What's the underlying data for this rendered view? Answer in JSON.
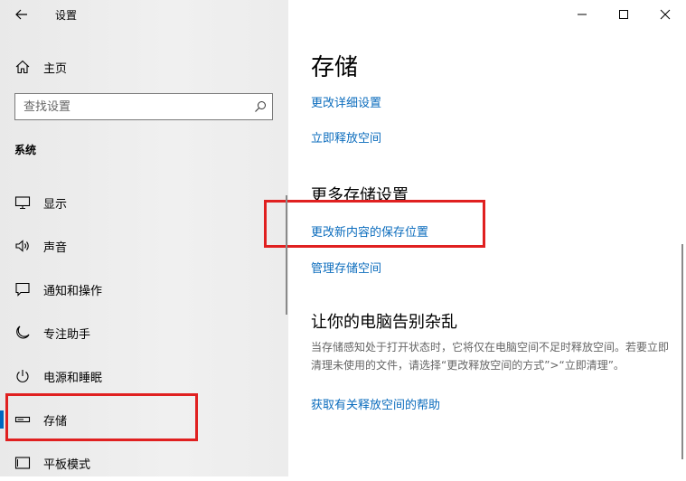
{
  "window": {
    "title": "设置"
  },
  "sidebar": {
    "home_label": "主页",
    "search_placeholder": "查找设置",
    "section_title": "系统",
    "items": [
      {
        "label": "显示",
        "icon": "monitor-icon"
      },
      {
        "label": "声音",
        "icon": "speaker-icon"
      },
      {
        "label": "通知和操作",
        "icon": "message-icon"
      },
      {
        "label": "专注助手",
        "icon": "moon-icon"
      },
      {
        "label": "电源和睡眠",
        "icon": "power-icon"
      },
      {
        "label": "存储",
        "icon": "storage-icon",
        "selected": true
      },
      {
        "label": "平板模式",
        "icon": "tablet-icon"
      }
    ]
  },
  "main": {
    "title": "存储",
    "links_top": [
      "更改详细设置",
      "立即释放空间"
    ],
    "more_title": "更多存储设置",
    "more_links": [
      "更改新内容的保存位置",
      "管理存储空间"
    ],
    "declutter_title": "让你的电脑告别杂乱",
    "declutter_desc": "当存储感知处于打开状态时，它将仅在电脑空间不足时释放空间。若要立即清理未使用的文件，请选择“更改释放空间的方式”>“立即清理”。",
    "help_link": "获取有关释放空间的帮助"
  },
  "colors": {
    "accent": "#0067c0",
    "link": "#0b6cbd",
    "highlight": "#e02020"
  }
}
